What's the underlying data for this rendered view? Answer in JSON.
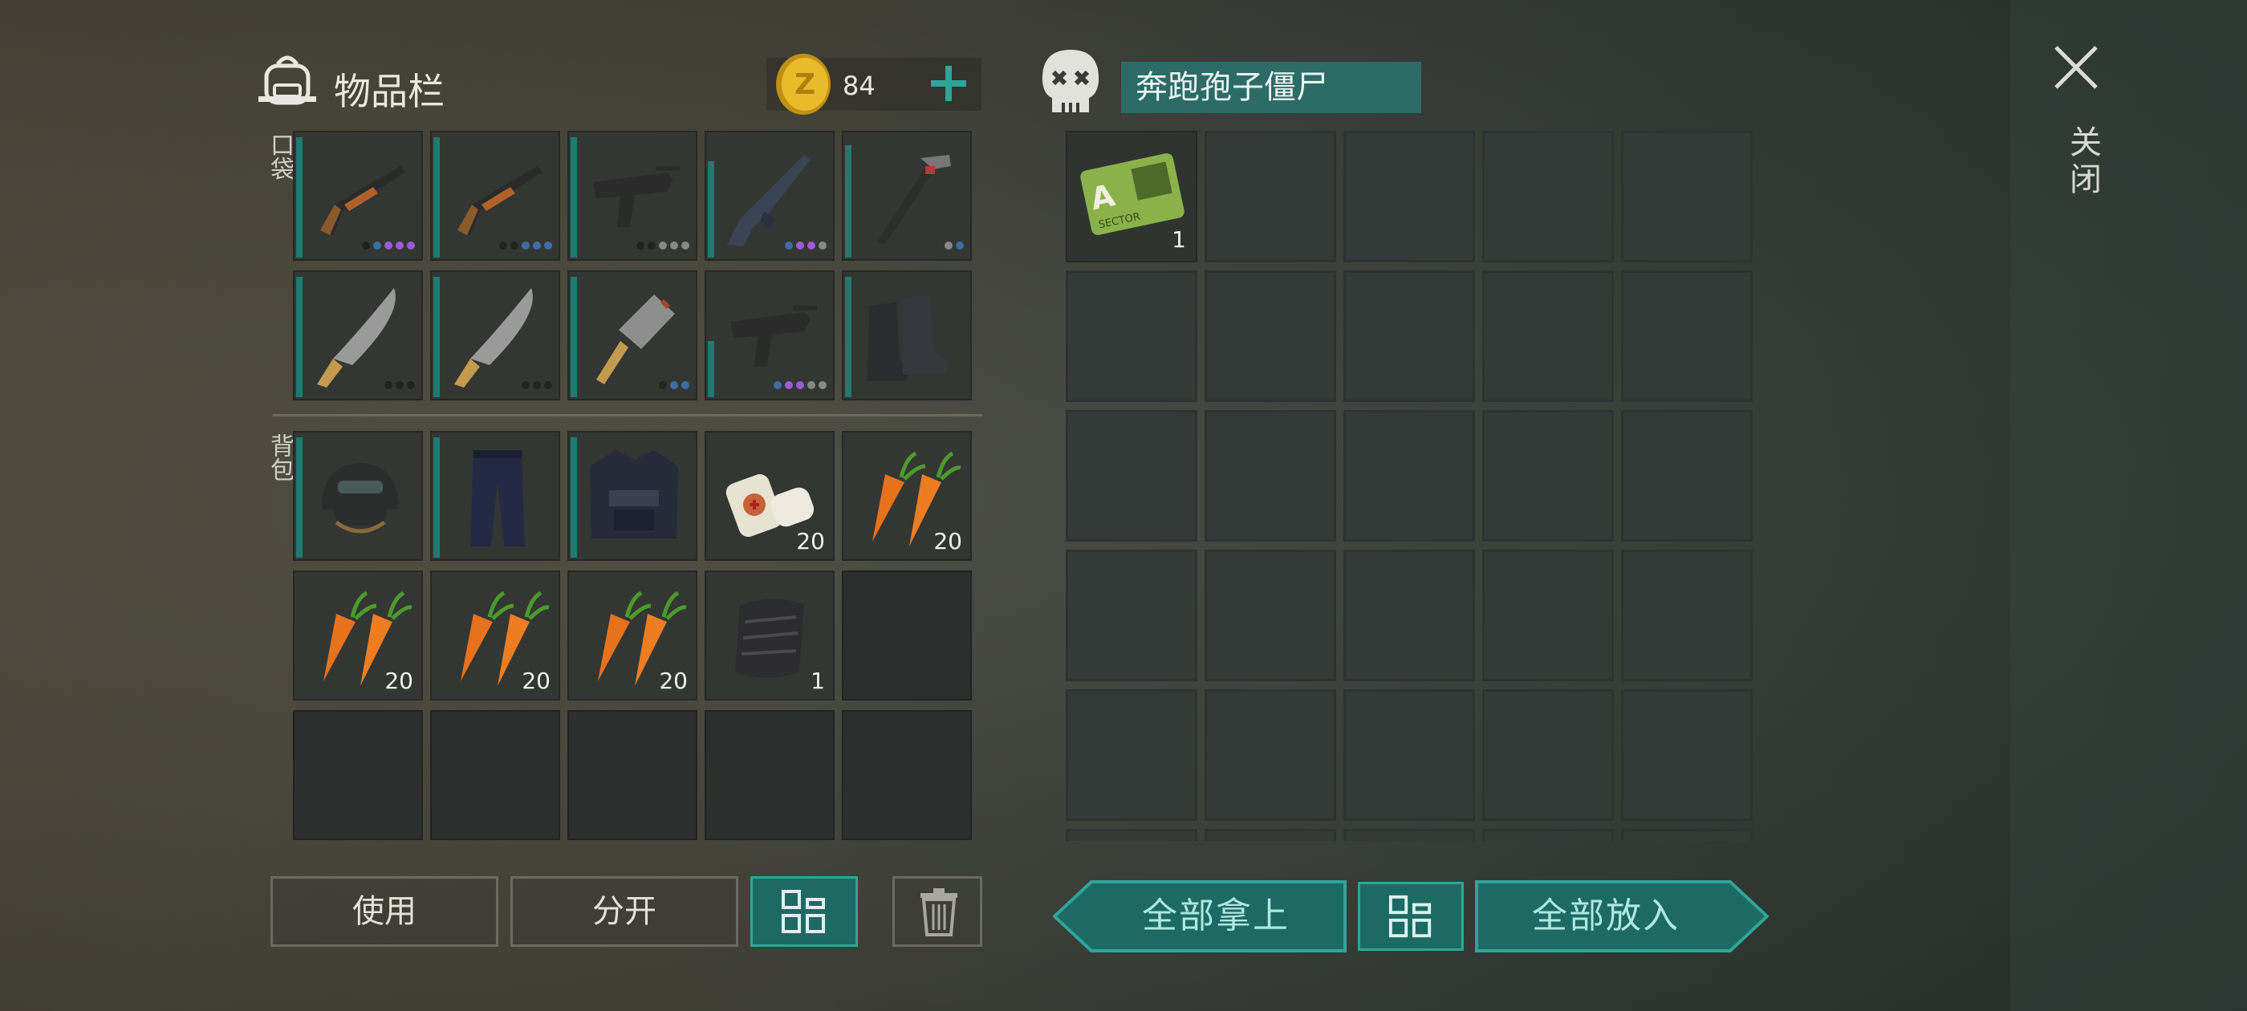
{
  "inventory": {
    "title": "物品栏",
    "coins": "84",
    "pocket_label": "口袋",
    "backpack_label": "背包",
    "pocket_items": [
      {
        "icon": "shotgun-icon",
        "name": "shotgun",
        "qty": ""
      },
      {
        "icon": "shotgun-icon",
        "name": "shotgun",
        "qty": ""
      },
      {
        "icon": "uzi-icon",
        "name": "smg",
        "qty": ""
      },
      {
        "icon": "rifle-icon",
        "name": "assault-rifle",
        "qty": ""
      },
      {
        "icon": "hammer-icon",
        "name": "hammer",
        "qty": ""
      },
      {
        "icon": "machete-icon",
        "name": "machete",
        "qty": ""
      },
      {
        "icon": "machete-icon",
        "name": "machete",
        "qty": ""
      },
      {
        "icon": "cleaver-icon",
        "name": "cleaver",
        "qty": ""
      },
      {
        "icon": "uzi-icon",
        "name": "smg",
        "qty": ""
      },
      {
        "icon": "boots-icon",
        "name": "boots",
        "qty": ""
      }
    ],
    "backpack_items": [
      {
        "icon": "helmet-icon",
        "name": "helmet",
        "qty": ""
      },
      {
        "icon": "pants-icon",
        "name": "pants",
        "qty": ""
      },
      {
        "icon": "vest-icon",
        "name": "armor-vest",
        "qty": ""
      },
      {
        "icon": "bandage-icon",
        "name": "bandage",
        "qty": "20"
      },
      {
        "icon": "carrot-icon",
        "name": "carrot",
        "qty": "20"
      },
      {
        "icon": "carrot-icon",
        "name": "carrot",
        "qty": "20"
      },
      {
        "icon": "carrot-icon",
        "name": "carrot",
        "qty": "20"
      },
      {
        "icon": "carrot-icon",
        "name": "carrot",
        "qty": "20"
      },
      {
        "icon": "cloth-icon",
        "name": "cloth",
        "qty": "1"
      },
      {
        "icon": "",
        "name": "empty",
        "qty": ""
      },
      {
        "icon": "",
        "name": "empty",
        "qty": ""
      },
      {
        "icon": "",
        "name": "empty",
        "qty": ""
      },
      {
        "icon": "",
        "name": "empty",
        "qty": ""
      },
      {
        "icon": "",
        "name": "empty",
        "qty": ""
      },
      {
        "icon": "",
        "name": "empty",
        "qty": ""
      }
    ]
  },
  "loot": {
    "title": "奔跑孢子僵尸",
    "items": [
      {
        "icon": "keycard-icon",
        "name": "sector-a-keycard",
        "qty": "1",
        "card_letter": "A",
        "card_text": "SECTOR"
      }
    ]
  },
  "close_label": "关闭",
  "buttons": {
    "use": "使用",
    "split": "分开",
    "take_all": "全部拿上",
    "put_all": "全部放入"
  },
  "colors": {
    "accent": "#2fa59a",
    "accent_dark": "#1d6a64",
    "durability": "#1f7a70",
    "coin": "#e2b428"
  }
}
